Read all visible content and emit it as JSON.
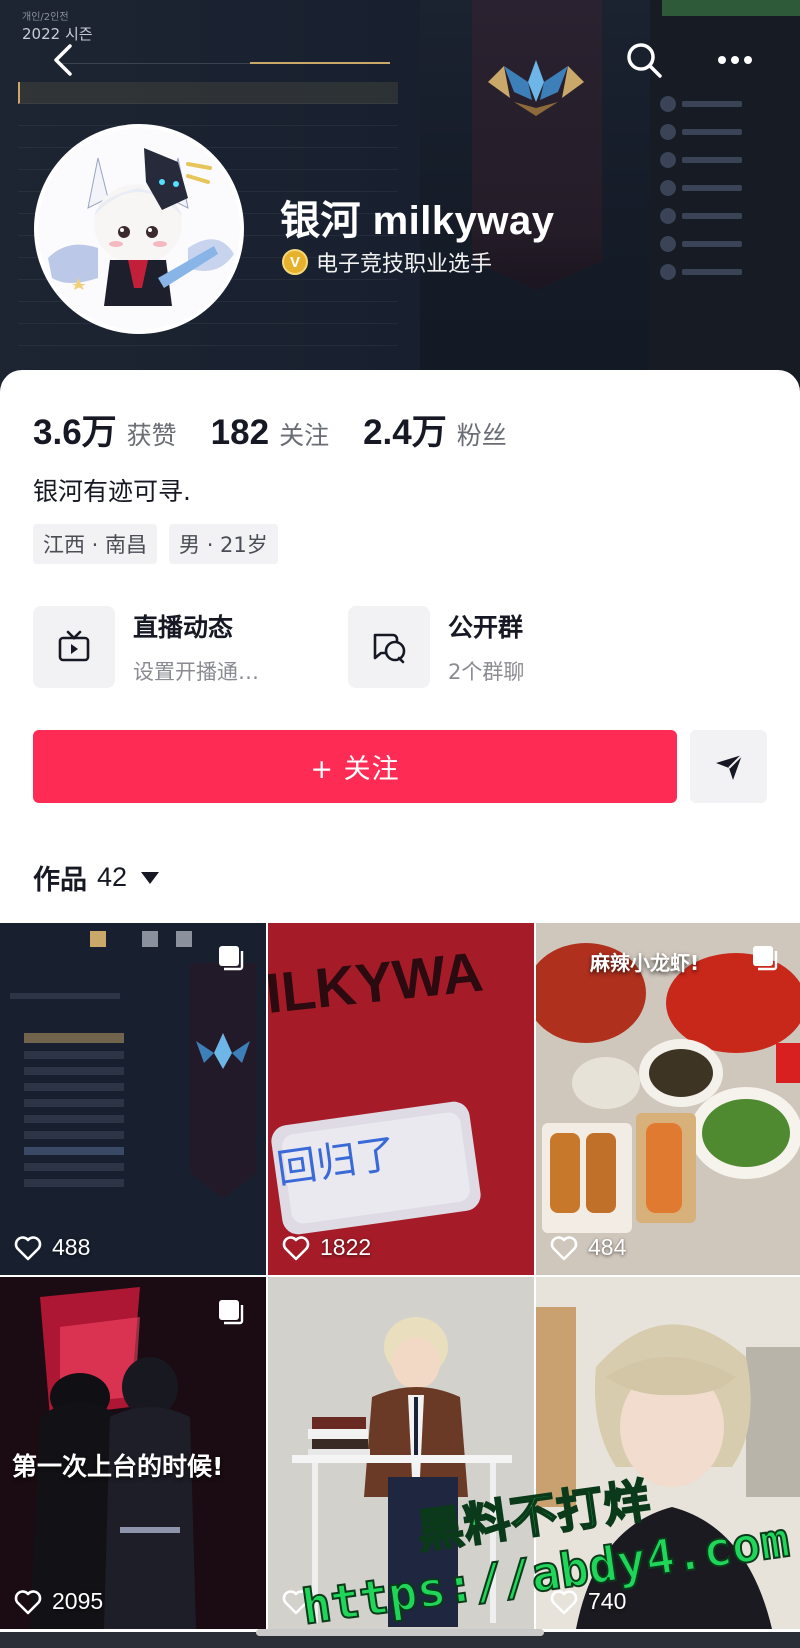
{
  "banner": {
    "season": "2022 시즌",
    "season_small": "개인/2인전"
  },
  "profile": {
    "nickname": "银河 milkyway",
    "verify_badge": "V",
    "verify_text": "电子竞技职业选手",
    "stats": [
      {
        "num": "3.6万",
        "label": "获赞"
      },
      {
        "num": "182",
        "label": "关注"
      },
      {
        "num": "2.4万",
        "label": "粉丝"
      }
    ],
    "bio": "银河有迹可寻.",
    "tags": [
      "江西 · 南昌",
      "男 · 21岁"
    ],
    "entries": [
      {
        "title": "直播动态",
        "subtitle": "设置开播通…"
      },
      {
        "title": "公开群",
        "subtitle": "2个群聊"
      }
    ],
    "follow_label": "+ 关注",
    "works_label": "作品",
    "works_count": "42"
  },
  "grid": [
    {
      "likes": "488",
      "caption": ""
    },
    {
      "likes": "1822",
      "caption": "回归了"
    },
    {
      "likes": "484",
      "caption": "麻辣小龙虾!"
    },
    {
      "likes": "2095",
      "caption": "第一次上台的时候!"
    },
    {
      "likes": "",
      "caption": ""
    },
    {
      "likes": "740",
      "caption": ""
    }
  ],
  "watermark": {
    "line1": "黑料不打烊",
    "line2": "https://abdy4.com"
  },
  "colors": {
    "accent": "#fe2c55",
    "verify_gold": "#e6b12c",
    "watermark_green": "#1fd65a"
  }
}
